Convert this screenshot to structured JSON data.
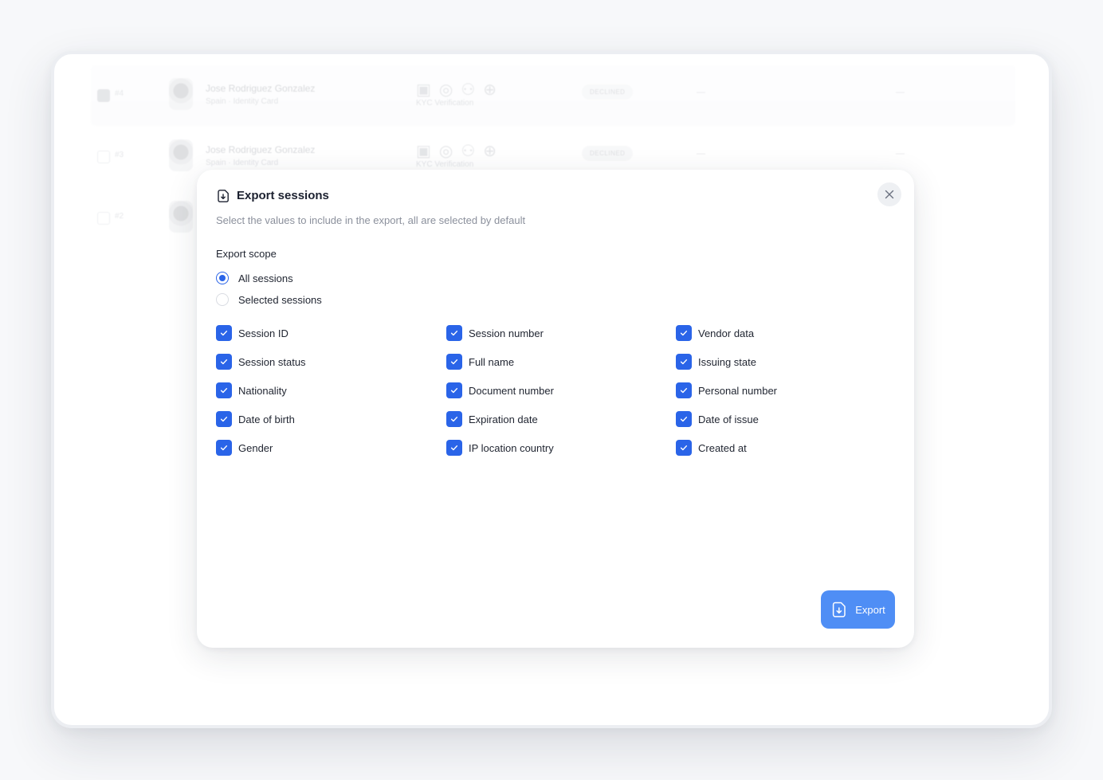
{
  "background_rows": [
    {
      "num": "#4",
      "name": "Jose Rodriguez Gonzalez",
      "sub": "Spain · Identity Card",
      "kyc": "KYC Verification",
      "badge": "DECLINED",
      "dash1": "—",
      "dash2": "—"
    },
    {
      "num": "#3",
      "name": "Jose Rodriguez Gonzalez",
      "sub": "Spain · Identity Card",
      "kyc": "KYC Verification",
      "badge": "DECLINED",
      "dash1": "—",
      "dash2": "—"
    },
    {
      "num": "#2"
    }
  ],
  "modal": {
    "title": "Export sessions",
    "subtitle": "Select the values to include in the export, all are selected by default",
    "close_icon": "close-icon",
    "scope": {
      "label": "Export scope",
      "options": [
        {
          "label": "All sessions",
          "selected": true
        },
        {
          "label": "Selected sessions",
          "selected": false
        }
      ]
    },
    "fields": [
      {
        "label": "Session ID",
        "checked": true
      },
      {
        "label": "Session number",
        "checked": true
      },
      {
        "label": "Vendor data",
        "checked": true
      },
      {
        "label": "Session status",
        "checked": true
      },
      {
        "label": "Full name",
        "checked": true
      },
      {
        "label": "Issuing state",
        "checked": true
      },
      {
        "label": "Nationality",
        "checked": true
      },
      {
        "label": "Document number",
        "checked": true
      },
      {
        "label": "Personal number",
        "checked": true
      },
      {
        "label": "Date of birth",
        "checked": true
      },
      {
        "label": "Expiration date",
        "checked": true
      },
      {
        "label": "Date of issue",
        "checked": true
      },
      {
        "label": "Gender",
        "checked": true
      },
      {
        "label": "IP location country",
        "checked": true
      },
      {
        "label": "Created at",
        "checked": true
      }
    ],
    "export_button": {
      "label": "Export",
      "icon": "file-export-icon"
    }
  },
  "colors": {
    "accent": "#2a64e8",
    "export_button": "#4f8ef5",
    "subtitle": "#8b909c"
  }
}
